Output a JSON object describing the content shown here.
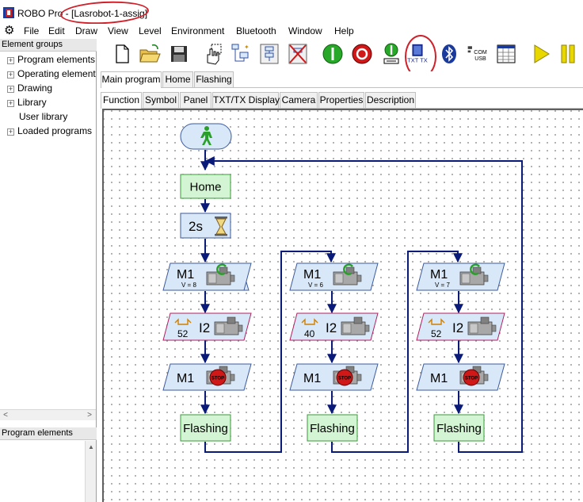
{
  "window": {
    "title": "ROBO Pro - ",
    "file": "[Lasrobot-1-assig]"
  },
  "menu": [
    "File",
    "Edit",
    "Draw",
    "View",
    "Level",
    "Environment",
    "Bluetooth",
    "Window",
    "Help"
  ],
  "left_panel": {
    "header": "Element groups",
    "tree": [
      {
        "label": "Program elements",
        "expandable": true
      },
      {
        "label": "Operating elements",
        "expandable": true
      },
      {
        "label": "Drawing",
        "expandable": true
      },
      {
        "label": "Library",
        "expandable": true
      },
      {
        "label": "User library",
        "expandable": false
      },
      {
        "label": "Loaded programs",
        "expandable": true
      }
    ],
    "bottom_header": "Program elements"
  },
  "toolbar": {
    "txt_label": "TXT TX",
    "com_label": "COM",
    "usb_label": "USB"
  },
  "program_tabs": [
    "Main program",
    "Home",
    "Flashing"
  ],
  "view_tabs": [
    "Function",
    "Symbol",
    "Panel",
    "TXT/TX Display",
    "Camera",
    "Properties",
    "Description"
  ],
  "flow": {
    "home_label": "Home",
    "wait_label": "2s",
    "columns": [
      {
        "motor": "M1",
        "speed": "V = 8",
        "input": "I2",
        "count": "52",
        "stop_motor": "M1",
        "stop_label": "STOP",
        "sub": "Flashing"
      },
      {
        "motor": "M1",
        "speed": "V = 6",
        "input": "I2",
        "count": "40",
        "stop_motor": "M1",
        "stop_label": "STOP",
        "sub": "Flashing"
      },
      {
        "motor": "M1",
        "speed": "V = 7",
        "input": "I2",
        "count": "52",
        "stop_motor": "M1",
        "stop_label": "STOP",
        "sub": "Flashing"
      }
    ]
  },
  "colors": {
    "connector": "#0a1a78",
    "annotation": "#d0202a",
    "start_green": "#2aa02a",
    "stop_red": "#d01818"
  }
}
